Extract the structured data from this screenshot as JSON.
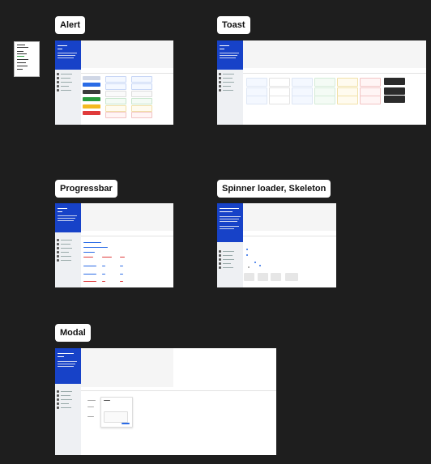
{
  "canvas": {
    "background": "#1e1e1e",
    "frames": [
      {
        "id": "alert",
        "label": "Alert"
      },
      {
        "id": "toast",
        "label": "Toast"
      },
      {
        "id": "progressbar",
        "label": "Progressbar"
      },
      {
        "id": "spinner",
        "label": "Spinner loader, Skeleton"
      },
      {
        "id": "modal",
        "label": "Modal"
      }
    ]
  },
  "colors": {
    "sidebar_blue": "#1742c8",
    "sidebar_gray": "#eef0f3",
    "topbar": "#f5f5f5",
    "primary": "#2a6be6",
    "dark": "#3b3b3b",
    "success": "#2a9c3e",
    "warning": "#f3b920",
    "danger": "#e03b3b"
  }
}
